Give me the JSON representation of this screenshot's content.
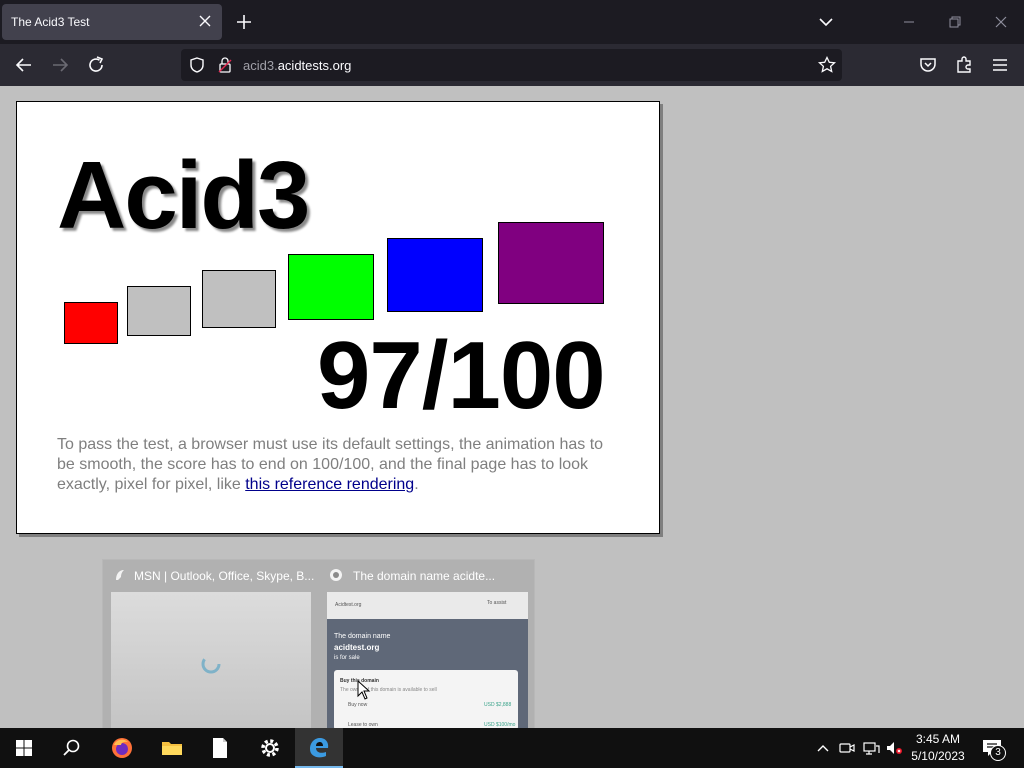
{
  "browser": {
    "tab": {
      "title": "The Acid3 Test"
    },
    "url": {
      "subdomain": "acid3.",
      "domain": "acidtests.org"
    }
  },
  "page": {
    "heading": "Acid3",
    "score": "97/100",
    "instructions_text": "To pass the test, a browser must use its default settings, the animation has to be smooth, the score has to end on 100/100, and the final page has to look exactly, pixel for pixel, like ",
    "reference_link": "this reference rendering",
    "instructions_end": ".",
    "bucket_colors": [
      "#ff0000",
      "#c0c0c0",
      "#c0c0c0",
      "#00ff00",
      "#0000ff",
      "#800080"
    ]
  },
  "taskbar_preview": {
    "windows": [
      {
        "title": "MSN | Outlook, Office, Skype, B..."
      },
      {
        "title": "The domain name acidte...",
        "thumb_header_left": "Acidtest.org",
        "thumb_header_right": "To assist",
        "thumb_line1": "The domain name",
        "thumb_line2": "acidtest.org",
        "thumb_line3": "is for sale",
        "thumb_card_title": "Buy this domain",
        "thumb_card_line": "The owner of this domain is available to sell",
        "thumb_option1": "Buy now",
        "thumb_option1_price": "USD $2,888",
        "thumb_option2": "Lease to own",
        "thumb_option2_price": "USD $100/mo"
      }
    ]
  },
  "taskbar": {
    "clock_time": "3:45 AM",
    "clock_date": "5/10/2023",
    "notification_count": "3"
  }
}
